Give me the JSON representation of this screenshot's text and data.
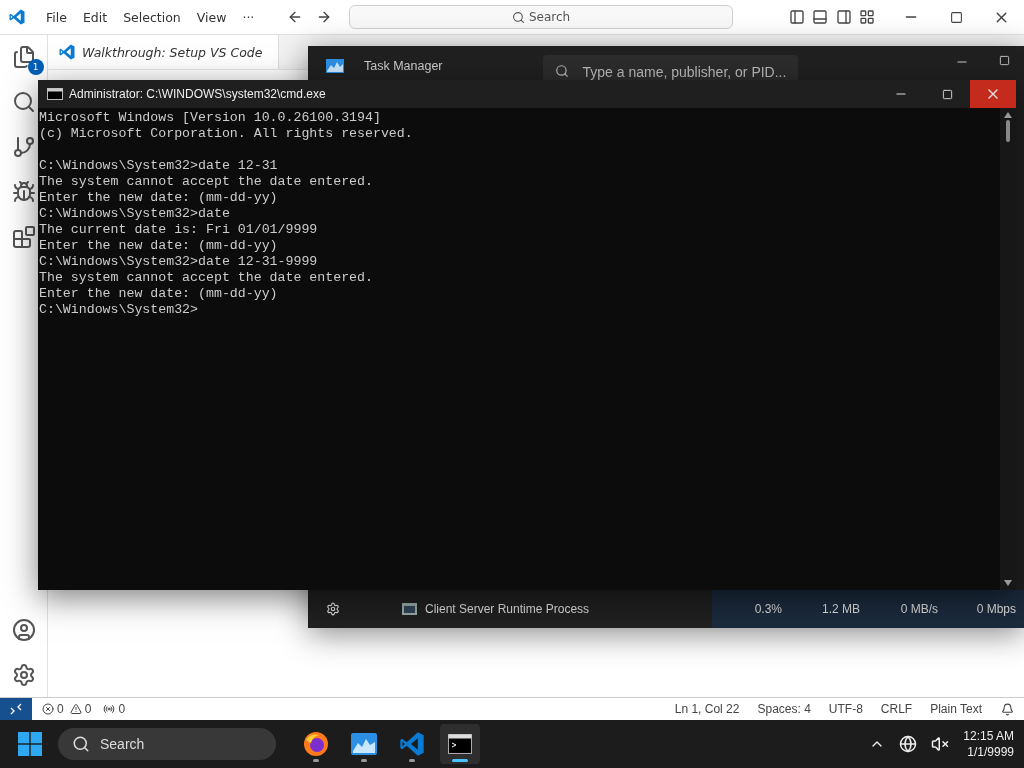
{
  "vscode": {
    "menu": [
      "File",
      "Edit",
      "Selection",
      "View",
      "···"
    ],
    "search": "Search",
    "explorer_badge": "1",
    "tab": "Walkthrough: Setup VS Code",
    "status": {
      "errors": "0",
      "warnings": "0",
      "ports": "0",
      "items": [
        "Ln 1, Col 22",
        "Spaces: 4",
        "UTF-8",
        "CRLF",
        "Plain Text"
      ]
    }
  },
  "task_manager": {
    "title": "Task Manager",
    "search": {
      "placeholder": "Type a name, publisher, or PID..."
    },
    "row": {
      "name": "Client Server Runtime Process",
      "cells": [
        "0.3%",
        "1.2 MB",
        "0 MB/s",
        "0 Mbps"
      ]
    }
  },
  "cmd": {
    "title": "Administrator: C:\\WINDOWS\\system32\\cmd.exe",
    "blocks": [
      [
        "Microsoft Windows [Version 10.0.26100.3194]",
        "(c) Microsoft Corporation. All rights reserved."
      ],
      [
        "C:\\Windows\\System32>date 12-31",
        "The system cannot accept the date entered.",
        "Enter the new date: (mm-dd-yy)",
        "C:\\Windows\\System32>date",
        "The current date is: Fri 01/01/9999",
        "Enter the new date: (mm-dd-yy)",
        "C:\\Windows\\System32>date 12-31-9999",
        "The system cannot accept the date entered.",
        "Enter the new date: (mm-dd-yy)",
        "C:\\Windows\\System32>"
      ]
    ]
  },
  "taskbar": {
    "search": "Search",
    "apps": [
      {
        "kind": "firefox",
        "selected": false
      },
      {
        "kind": "taskmgr",
        "selected": false
      },
      {
        "kind": "vscode",
        "selected": false
      },
      {
        "kind": "terminal",
        "selected": true
      }
    ],
    "time": "12:15 AM",
    "date": "1/1/9999"
  }
}
